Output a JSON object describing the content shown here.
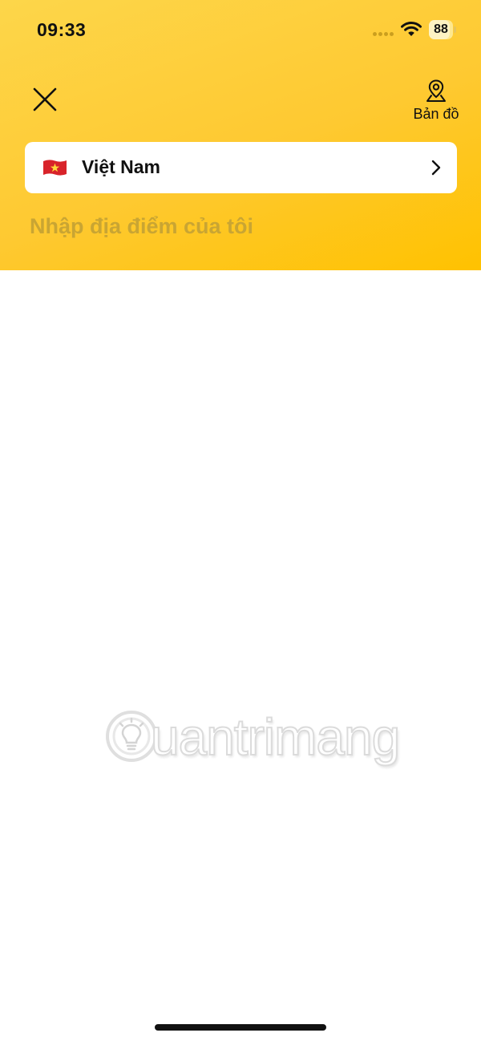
{
  "status_bar": {
    "time": "09:33",
    "battery_level": "88",
    "battery_fraction": 0.88
  },
  "header": {
    "close_icon": "close-icon",
    "map_icon": "map-pin-icon",
    "map_label": "Bản đồ"
  },
  "country_selector": {
    "flag_icon": "vietnam-flag-icon",
    "country_name": "Việt Nam",
    "chevron_icon": "chevron-right-icon"
  },
  "location_input": {
    "value": "",
    "placeholder": "Nhập địa điểm của tôi"
  },
  "watermark": {
    "text": "uantrimang",
    "logo_icon": "lightbulb-logo-icon"
  },
  "colors": {
    "header_gradient_start": "#fdd64a",
    "header_gradient_end": "#ffc200",
    "placeholder": "#c9a533",
    "card": "#ffffff",
    "text": "#111111"
  }
}
